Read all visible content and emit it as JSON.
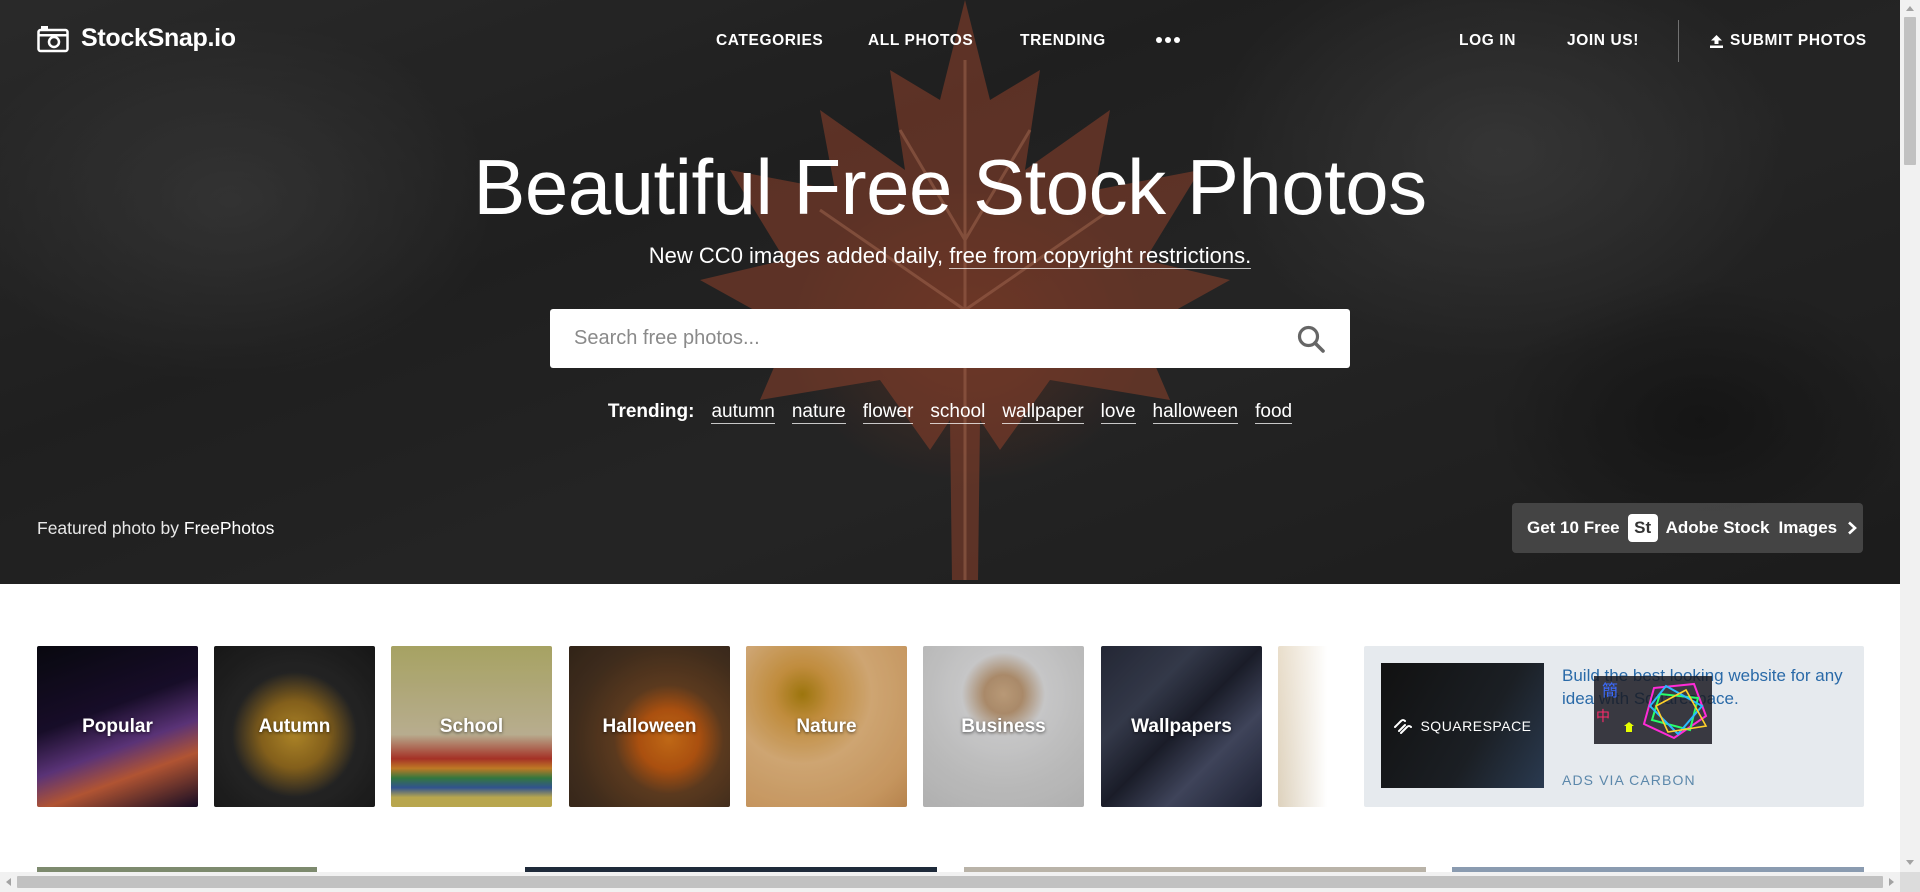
{
  "brand": {
    "name": "StockSnap.io",
    "logo_icon": "camera-icon"
  },
  "nav": {
    "links": [
      "CATEGORIES",
      "ALL PHOTOS",
      "TRENDING"
    ],
    "more_icon": "ellipsis-icon",
    "login": "LOG IN",
    "join": "JOIN US!",
    "submit": "SUBMIT PHOTOS",
    "submit_icon": "upload-icon"
  },
  "hero": {
    "title": "Beautiful Free Stock Photos",
    "subtitle_prefix": "New CC0 images added daily, ",
    "subtitle_link": "free from copyright restrictions.",
    "search_placeholder": "Search free photos...",
    "trending_label": "Trending:",
    "trending_tags": [
      "autumn",
      "nature",
      "flower",
      "school",
      "wallpaper",
      "love",
      "halloween",
      "food"
    ],
    "featured_prefix": "Featured photo by ",
    "featured_author": "FreePhotos",
    "adobe": {
      "prefix": "Get 10 Free",
      "badge": "St",
      "brand": "Adobe Stock",
      "suffix": "Images"
    }
  },
  "categories": [
    "Popular",
    "Autumn",
    "School",
    "Halloween",
    "Nature",
    "Business",
    "Wallpapers"
  ],
  "ad": {
    "brand": "SQUARESPACE",
    "text": "Build the best looking website for any idea with Squarespace.",
    "via": "ADS VIA CARBON"
  },
  "colors": {
    "link_blue": "#2a6aa8",
    "ad_bg": "#e6eaee"
  }
}
